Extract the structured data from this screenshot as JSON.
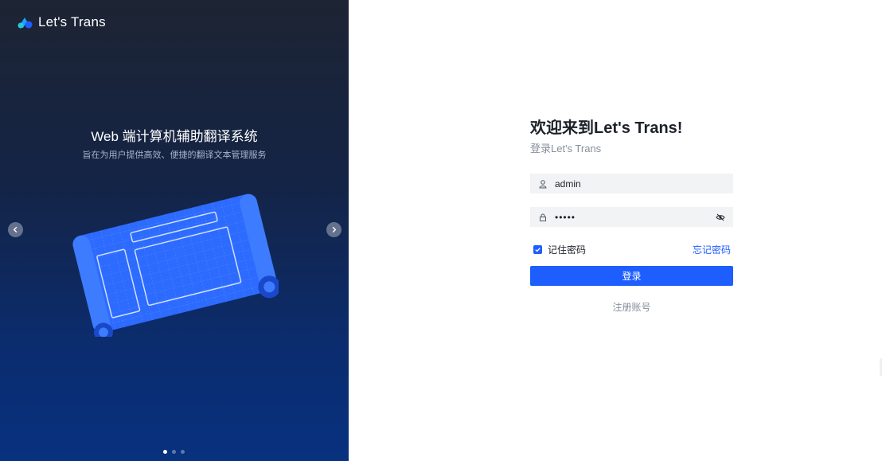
{
  "brand": {
    "name": "Let's Trans",
    "icon": "logo-icon"
  },
  "carousel": {
    "title": "Web 端计算机辅助翻译系统",
    "subtitle": "旨在为用户提供高效、便捷的翻译文本管理服务",
    "slide_count": 3,
    "active_slide": 1
  },
  "login": {
    "welcome": "欢迎来到Let's Trans!",
    "subtitle": "登录Let's Trans",
    "username_value": "admin",
    "password_value": "•••••",
    "remember_label": "记住密码",
    "remember_checked": true,
    "forgot_label": "忘记密码",
    "submit_label": "登录",
    "register_label": "注册账号"
  },
  "colors": {
    "accent": "#1e5eff",
    "panel_dark": "#142446",
    "input_bg": "#f2f3f5"
  }
}
